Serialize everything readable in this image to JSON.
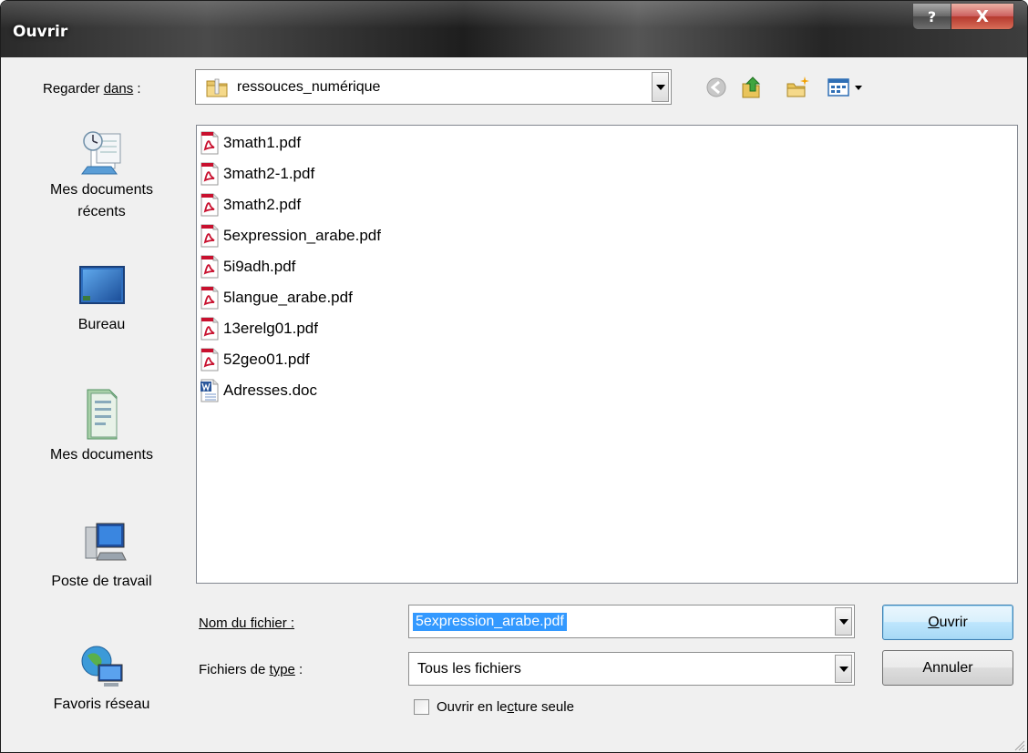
{
  "window": {
    "title": "Ouvrir",
    "help_glyph": "?",
    "close_glyph": "X"
  },
  "look_in": {
    "label_prefix": "Regarder ",
    "label_accel": "dans",
    "label_suffix": " :",
    "value": "ressouces_numérique"
  },
  "toolbar": {
    "icons": [
      "back-icon",
      "up-folder-icon",
      "new-folder-icon",
      "views-menu-icon"
    ]
  },
  "places": [
    {
      "label_line1": "Mes documents",
      "label_line2": "récents",
      "icon": "recent-documents-icon"
    },
    {
      "label_line1": "Bureau",
      "label_line2": "",
      "icon": "desktop-icon"
    },
    {
      "label_line1": "Mes documents",
      "label_line2": "",
      "icon": "my-documents-icon"
    },
    {
      "label_line1": "Poste de travail",
      "label_line2": "",
      "icon": "my-computer-icon"
    },
    {
      "label_line1": "Favoris réseau",
      "label_line2": "",
      "icon": "network-places-icon"
    }
  ],
  "files": [
    {
      "name": "3math1.pdf",
      "type": "pdf"
    },
    {
      "name": "3math2-1.pdf",
      "type": "pdf"
    },
    {
      "name": "3math2.pdf",
      "type": "pdf"
    },
    {
      "name": "5expression_arabe.pdf",
      "type": "pdf"
    },
    {
      "name": "5i9adh.pdf",
      "type": "pdf"
    },
    {
      "name": "5langue_arabe.pdf",
      "type": "pdf"
    },
    {
      "name": "13erelg01.pdf",
      "type": "pdf"
    },
    {
      "name": "52geo01.pdf",
      "type": "pdf"
    },
    {
      "name": "Adresses.doc",
      "type": "doc"
    }
  ],
  "filename": {
    "label": "Nom du fichier :",
    "value": "5expression_arabe.pdf"
  },
  "filetype": {
    "label_prefix": "Fichiers de ",
    "label_accel": "type",
    "label_suffix": " :",
    "value": "Tous les fichiers"
  },
  "readonly": {
    "label_prefix": "Ouvrir en le",
    "label_accel": "c",
    "label_suffix": "ture seule",
    "checked": false
  },
  "buttons": {
    "open_accel": "O",
    "open_rest": "uvrir",
    "cancel": "Annuler"
  },
  "colors": {
    "selection": "#3399ff",
    "pdf_red": "#c8102e",
    "word_blue": "#2b579a"
  }
}
